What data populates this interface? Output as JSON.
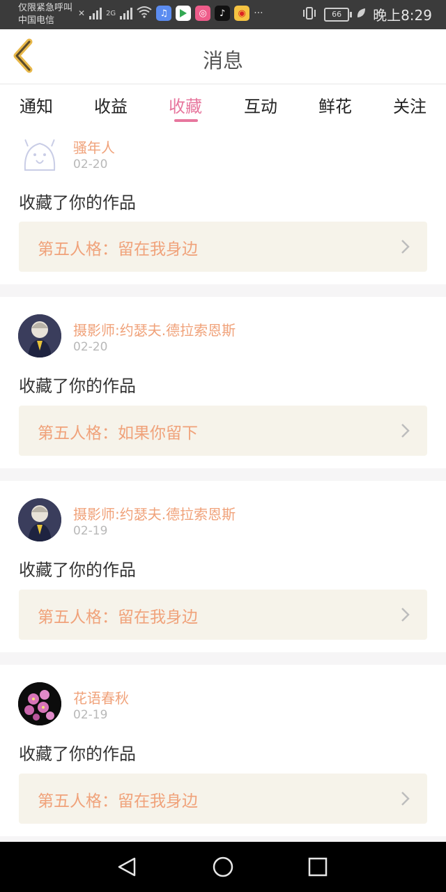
{
  "status_bar": {
    "emergency_text": "仅限紧急呼叫",
    "carrier": "中国电信",
    "network": "2G",
    "battery": "66",
    "time": "晚上8:29",
    "more": "···"
  },
  "header": {
    "title": "消息"
  },
  "tabs": [
    {
      "label": "通知"
    },
    {
      "label": "收益"
    },
    {
      "label": "收藏"
    },
    {
      "label": "互动"
    },
    {
      "label": "鲜花"
    },
    {
      "label": "关注"
    }
  ],
  "active_tab": "收藏",
  "colors": {
    "accent": "#e7779e",
    "name": "#f0a27a",
    "card_bg": "#f6f3ea"
  },
  "messages": [
    {
      "user": "骚年人",
      "date": "02-20",
      "action": "收藏了你的作品",
      "work": "第五人格：留在我身边"
    },
    {
      "user": "摄影师:约瑟夫.德拉索恩斯",
      "date": "02-20",
      "action": "收藏了你的作品",
      "work": "第五人格：如果你留下"
    },
    {
      "user": "摄影师:约瑟夫.德拉索恩斯",
      "date": "02-19",
      "action": "收藏了你的作品",
      "work": "第五人格：留在我身边"
    },
    {
      "user": "花语春秋",
      "date": "02-19",
      "action": "收藏了你的作品",
      "work": "第五人格：留在我身边"
    }
  ]
}
